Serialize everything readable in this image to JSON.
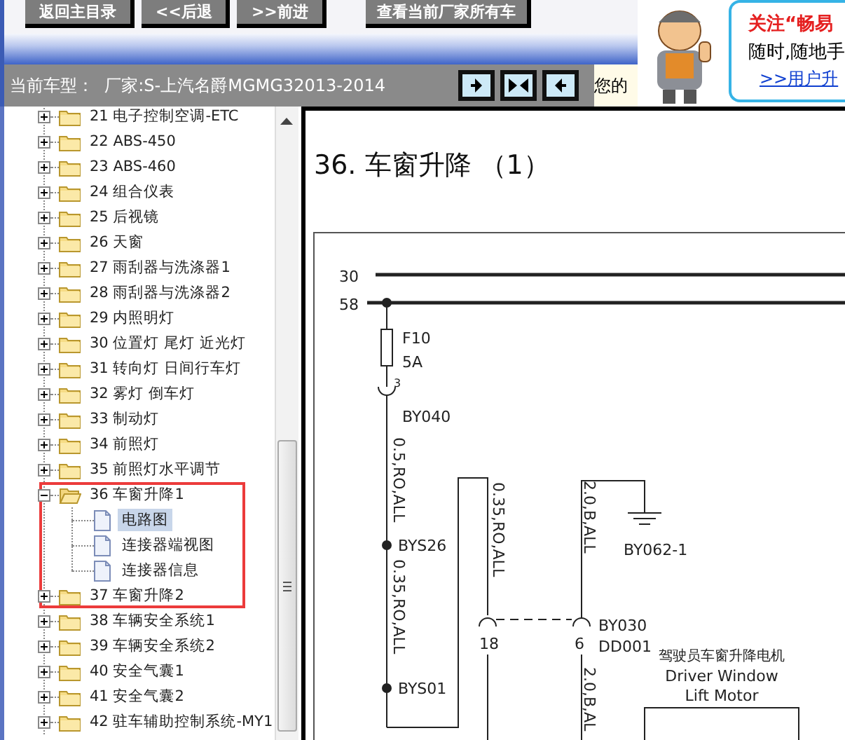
{
  "toolbar": {
    "buttons": [
      "返回主目录",
      "<<后退",
      ">>前进",
      "查看当前厂家所有车"
    ]
  },
  "vehicle_bar": {
    "label": "当前车型：",
    "value": "厂家:S-上汽名爵MGMG32013-2014",
    "notice": "您的"
  },
  "ad": {
    "headline": "关注“畅易",
    "line": "随时,随地手",
    "link": ">>用户升"
  },
  "tree": {
    "items": [
      {
        "label": "21 电子控制空调-ETC",
        "expanded": false
      },
      {
        "label": "22 ABS-450",
        "expanded": false
      },
      {
        "label": "23 ABS-460",
        "expanded": false
      },
      {
        "label": "24 组合仪表",
        "expanded": false
      },
      {
        "label": "25 后视镜",
        "expanded": false
      },
      {
        "label": "26 天窗",
        "expanded": false
      },
      {
        "label": "27 雨刮器与洗涤器1",
        "expanded": false
      },
      {
        "label": "28 雨刮器与洗涤器2",
        "expanded": false
      },
      {
        "label": "29 内照明灯",
        "expanded": false
      },
      {
        "label": "30 位置灯 尾灯 近光灯",
        "expanded": false
      },
      {
        "label": "31 转向灯 日间行车灯",
        "expanded": false
      },
      {
        "label": "32 雾灯 倒车灯",
        "expanded": false
      },
      {
        "label": "33 制动灯",
        "expanded": false
      },
      {
        "label": "34 前照灯",
        "expanded": false
      },
      {
        "label": "35 前照灯水平调节",
        "expanded": false
      },
      {
        "label": "36 车窗升降1",
        "expanded": true,
        "children": [
          {
            "label": "电路图",
            "selected": true
          },
          {
            "label": "连接器端视图",
            "selected": false
          },
          {
            "label": "连接器信息",
            "selected": false
          }
        ]
      },
      {
        "label": "37 车窗升降2",
        "expanded": false
      },
      {
        "label": "38 车辆安全系统1",
        "expanded": false
      },
      {
        "label": "39 车辆安全系统2",
        "expanded": false
      },
      {
        "label": "40 安全气囊1",
        "expanded": false
      },
      {
        "label": "41 安全气囊2",
        "expanded": false
      },
      {
        "label": "42 驻车辅助控制系统-MY1",
        "expanded": false
      }
    ]
  },
  "document": {
    "title": "36. 车窗升降 （1）",
    "diagram_labels": [
      "30",
      "58",
      "F10",
      "5A",
      "3",
      "BY040",
      "0.5,RO,ALL",
      "BYS26",
      "0.35,RO,ALL",
      "BYS01",
      "0.35,RO,ALL",
      "2.0,B,ALL",
      "BY062-1",
      "18",
      "6",
      "BY030",
      "DD001",
      "驾驶员车窗升降电机",
      "Driver Window",
      "Lift Motor",
      "2.0,B,AL"
    ]
  }
}
